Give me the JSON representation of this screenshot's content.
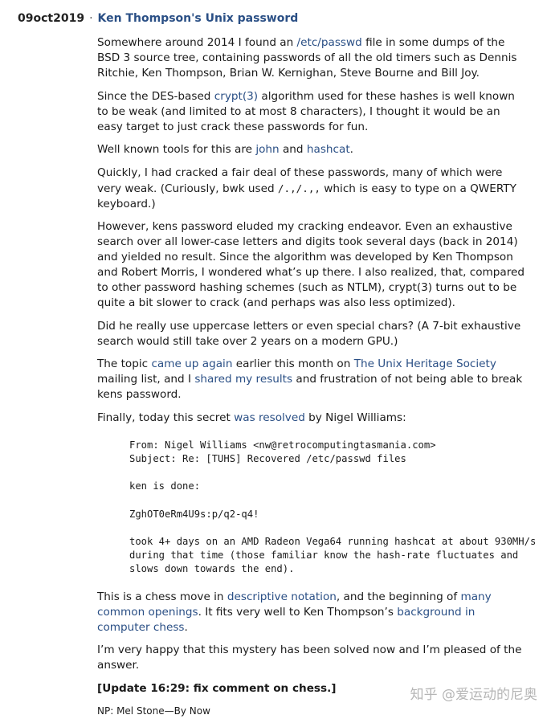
{
  "header": {
    "date": "09oct2019",
    "separator": "·",
    "title": "Ken Thompson's Unix password"
  },
  "p1": {
    "t1": "Somewhere around 2014 I found an ",
    "link": "/etc/passwd",
    "t2": " file in some dumps of the BSD 3 source tree, containing passwords of all the old timers such as Dennis Ritchie, Ken Thompson, Brian W. Kernighan, Steve Bourne and Bill Joy."
  },
  "p2": {
    "t1": "Since the DES-based ",
    "link": "crypt(3)",
    "t2": " algorithm used for these hashes is well known to be weak (and limited to at most 8 characters), I thought it would be an easy target to just crack these passwords for fun."
  },
  "p3": {
    "t1": "Well known tools for this are ",
    "link1": "john",
    "t2": " and ",
    "link2": "hashcat",
    "t3": "."
  },
  "p4": {
    "t1": "Quickly, I had cracked a fair deal of these passwords, many of which were very weak. (Curiously, bwk used ",
    "code": "/.,/.,,",
    "t2": " which is easy to type on a QWERTY keyboard.)"
  },
  "p5": {
    "text": "However, kens password eluded my cracking endeavor. Even an exhaustive search over all lower-case letters and digits took several days (back in 2014) and yielded no result. Since the algorithm was developed by Ken Thompson and Robert Morris, I wondered what’s up there. I also realized, that, compared to other password hashing schemes (such as NTLM), crypt(3) turns out to be quite a bit slower to crack (and perhaps was also less optimized)."
  },
  "p6": {
    "text": "Did he really use uppercase letters or even special chars? (A 7-bit exhaustive search would still take over 2 years on a modern GPU.)"
  },
  "p7": {
    "t1": "The topic ",
    "link1": "came up again",
    "t2": " earlier this month on ",
    "link2": "The Unix Heritage Society",
    "t3": " mailing list, and I ",
    "link3": "shared my results",
    "t4": " and frustration of not being able to break kens password."
  },
  "p8": {
    "t1": "Finally, today this secret ",
    "link": "was resolved",
    "t2": " by Nigel Williams:"
  },
  "mail": {
    "from": "From: Nigel Williams <nw@retrocomputingtasmania.com>",
    "subject": "Subject: Re: [TUHS] Recovered /etc/passwd files",
    "line1": "ken is done:",
    "password": "ZghOT0eRm4U9s:p/q2-q4!",
    "line3a": "took 4+ days on an AMD Radeon Vega64 running hashcat at about 930MH/s",
    "line3b": "during that time (those familiar know the hash-rate fluctuates and",
    "line3c": "slows down towards the end)."
  },
  "p9": {
    "t1": "This is a chess move in ",
    "link1": "descriptive notation",
    "t2": ", and the beginning of ",
    "link2": "many common openings",
    "t3": ". It fits very well to Ken Thompson’s ",
    "link3": "background in computer chess",
    "t4": "."
  },
  "p10": {
    "text": "I’m very happy that this mystery has been solved now and I’m pleased of the answer."
  },
  "update": "[Update 16:29: fix comment on chess.]",
  "np": "NP: Mel Stone—By Now",
  "watermark": "知乎 @爱运动的尼奥"
}
